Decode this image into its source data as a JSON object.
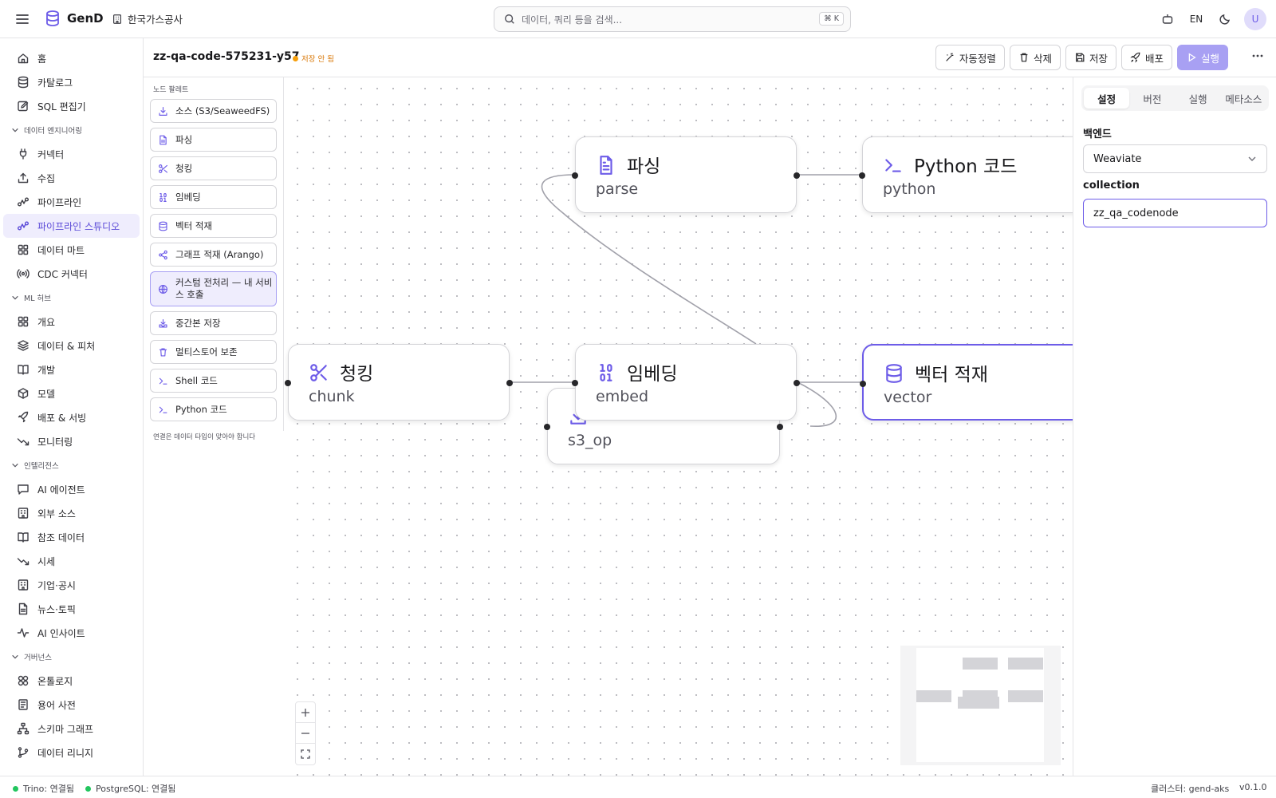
{
  "app": {
    "name": "GenD",
    "org": "한국가스공사"
  },
  "search": {
    "placeholder": "데이터, 쿼리 등을 검색...",
    "shortcut": "⌘ K"
  },
  "topbar": {
    "lang": "EN",
    "avatar": "U"
  },
  "sidebar": {
    "top_items": [
      {
        "label": "홈",
        "icon": "home-icon"
      },
      {
        "label": "카탈로그",
        "icon": "database-icon"
      },
      {
        "label": "SQL 편집기",
        "icon": "edit-icon"
      }
    ],
    "sections": [
      {
        "title": "데이터 엔지니어링",
        "items": [
          {
            "label": "커넥터",
            "icon": "plug-icon"
          },
          {
            "label": "수집",
            "icon": "upload-icon"
          },
          {
            "label": "파이프라인",
            "icon": "workflow-icon"
          },
          {
            "label": "파이프라인 스튜디오",
            "icon": "workflow-icon",
            "active": true
          },
          {
            "label": "데이터 마트",
            "icon": "grid-icon"
          },
          {
            "label": "CDC 커넥터",
            "icon": "radio-icon"
          }
        ]
      },
      {
        "title": "ML 허브",
        "items": [
          {
            "label": "개요",
            "icon": "grid-icon"
          },
          {
            "label": "데이터 & 피처",
            "icon": "layers-icon"
          },
          {
            "label": "개발",
            "icon": "book-icon"
          },
          {
            "label": "모델",
            "icon": "box-icon"
          },
          {
            "label": "배포 & 서빙",
            "icon": "rocket-icon"
          },
          {
            "label": "모니터링",
            "icon": "trend-icon"
          }
        ]
      },
      {
        "title": "인텔리전스",
        "items": [
          {
            "label": "AI 에이전트",
            "icon": "chat-icon"
          },
          {
            "label": "외부 소스",
            "icon": "building-icon"
          },
          {
            "label": "참조 데이터",
            "icon": "book-icon"
          },
          {
            "label": "시세",
            "icon": "trend-icon"
          },
          {
            "label": "기업·공시",
            "icon": "building-icon"
          },
          {
            "label": "뉴스·토픽",
            "icon": "file-icon"
          },
          {
            "label": "AI 인사이트",
            "icon": "activity-icon"
          }
        ]
      },
      {
        "title": "거버넌스",
        "items": [
          {
            "label": "온톨로지",
            "icon": "boxes-icon"
          },
          {
            "label": "용어 사전",
            "icon": "list-icon"
          },
          {
            "label": "스키마 그래프",
            "icon": "hierarchy-icon"
          },
          {
            "label": "데이터 리니지",
            "icon": "branch-icon"
          }
        ]
      }
    ]
  },
  "pipeline": {
    "title": "zz-qa-code-575231-y57",
    "status": "저장 안 됨"
  },
  "toolbar": {
    "auto_layout": "자동정렬",
    "delete": "삭제",
    "save": "저장",
    "deploy": "배포",
    "run": "실행"
  },
  "palette": {
    "title": "노드 팔레트",
    "items": [
      {
        "label": "소스 (S3/SeaweedFS)",
        "icon": "download-icon"
      },
      {
        "label": "파싱",
        "icon": "file-icon"
      },
      {
        "label": "청킹",
        "icon": "scissors-icon"
      },
      {
        "label": "임베딩",
        "icon": "binary-icon"
      },
      {
        "label": "벡터 적재",
        "icon": "database-icon"
      },
      {
        "label": "그래프 적재 (Arango)",
        "icon": "share-icon"
      },
      {
        "label": "커스텀 전처리 — 내 서비스 호출",
        "icon": "globe-icon",
        "highlight": true
      },
      {
        "label": "중간본 저장",
        "icon": "save-down-icon"
      },
      {
        "label": "멀티스토어 보존",
        "icon": "trash-icon"
      },
      {
        "label": "Shell 코드",
        "icon": "terminal-icon"
      },
      {
        "label": "Python 코드",
        "icon": "terminal-icon"
      }
    ],
    "footer": "연결은 데이터 타입이 맞아야 합니다"
  },
  "nodes": [
    {
      "key": "s3_op",
      "title": "",
      "id": "s3_op",
      "icon": "download-icon"
    },
    {
      "key": "parse",
      "title": "파싱",
      "id": "parse",
      "icon": "file-icon"
    },
    {
      "key": "python",
      "title": "Python 코드",
      "id": "python",
      "icon": "terminal-icon"
    },
    {
      "key": "chunk",
      "title": "청킹",
      "id": "chunk",
      "icon": "scissors-icon"
    },
    {
      "key": "embed",
      "title": "임베딩",
      "id": "embed",
      "icon": "binary-icon"
    },
    {
      "key": "vector",
      "title": "벡터 적재",
      "id": "vector",
      "icon": "database-icon",
      "selected": true
    }
  ],
  "right_panel": {
    "tabs": [
      "설정",
      "버전",
      "실행",
      "메타소스"
    ],
    "active_tab": "설정",
    "backend_label": "백엔드",
    "backend_value": "Weaviate",
    "collection_label": "collection",
    "collection_value": "zz_qa_codenode"
  },
  "status": {
    "trino": "Trino: 연결됨",
    "postgres": "PostgreSQL: 연결됨",
    "cluster": "클러스터: gend-aks",
    "version": "v0.1.0"
  },
  "colors": {
    "accent": "#6d5ce8",
    "ok": "#22c55e",
    "warn": "#f59e0b"
  }
}
